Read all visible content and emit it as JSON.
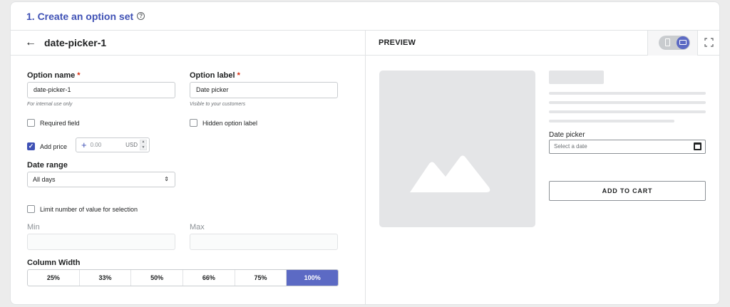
{
  "header": {
    "title": "1. Create an option set"
  },
  "editor": {
    "title": "date-picker-1",
    "option_name": {
      "label": "Option name",
      "required_mark": "*",
      "value": "date-picker-1",
      "help": "For internal use only"
    },
    "option_label": {
      "label": "Option label",
      "required_mark": "*",
      "value": "Date picker",
      "help": "Visible to your customers"
    },
    "required_field": {
      "label": "Required field",
      "checked": false
    },
    "hidden_label": {
      "label": "Hidden option label",
      "checked": false
    },
    "add_price": {
      "label": "Add price",
      "checked": true,
      "value": "0.00",
      "currency": "USD"
    },
    "date_range": {
      "label": "Date range",
      "selected": "All days"
    },
    "limit": {
      "label": "Limit number of value for selection",
      "checked": false
    },
    "min": {
      "label": "Min",
      "value": ""
    },
    "max": {
      "label": "Max",
      "value": ""
    },
    "column_width": {
      "label": "Column Width",
      "options": [
        "25%",
        "33%",
        "50%",
        "66%",
        "75%",
        "100%"
      ],
      "selected": "100%"
    }
  },
  "preview": {
    "title": "PREVIEW",
    "field_label": "Date picker",
    "field_placeholder": "Select a date",
    "cart_button": "ADD TO CART"
  },
  "colors": {
    "accent": "#3f51b5",
    "selected": "#5c6ac4",
    "required": "#d82c0d"
  }
}
